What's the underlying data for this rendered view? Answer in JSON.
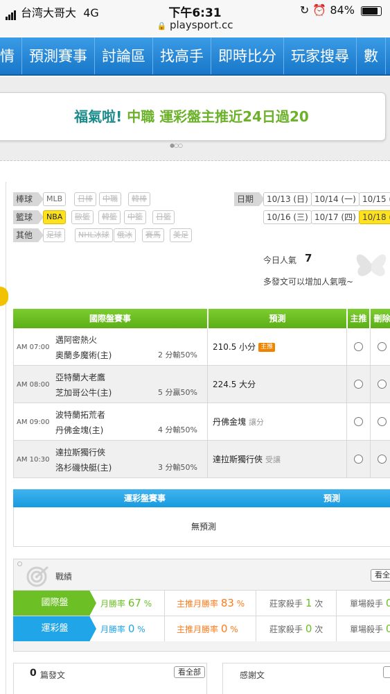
{
  "status_bar": {
    "carrier": "台湾大哥大",
    "network": "4G",
    "time": "下午6:31",
    "url": "playsport.cc",
    "battery": "84%",
    "battery_level": 0.84
  },
  "nav": {
    "items": [
      "情",
      "預測賽事",
      "討論區",
      "找高手",
      "即時比分",
      "玩家搜尋",
      "數"
    ]
  },
  "banner": {
    "prefix": "福氣啦!",
    "league": "中職",
    "text": "運彩盤主推近24日過20"
  },
  "filters": {
    "groups": [
      {
        "label": "棒球",
        "chips": [
          {
            "text": "MLB",
            "state": "normal"
          },
          {
            "text": "日棒",
            "state": "disabled"
          },
          {
            "text": "中職",
            "state": "disabled"
          },
          {
            "text": "韓棒",
            "state": "disabled"
          }
        ]
      },
      {
        "label": "籃球",
        "chips": [
          {
            "text": "NBA",
            "state": "active"
          },
          {
            "text": "歐籃",
            "state": "disabled"
          },
          {
            "text": "韓籃",
            "state": "disabled"
          },
          {
            "text": "中籃",
            "state": "disabled"
          },
          {
            "text": "日籃",
            "state": "disabled"
          }
        ]
      },
      {
        "label": "其他",
        "chips": [
          {
            "text": "足球",
            "state": "disabled"
          },
          {
            "text": "NHL冰球",
            "state": "disabled"
          },
          {
            "text": "俄冰",
            "state": "disabled"
          },
          {
            "text": "賽馬",
            "state": "disabled"
          },
          {
            "text": "美足",
            "state": "disabled"
          }
        ]
      }
    ],
    "date_label": "日期",
    "dates": [
      {
        "text": "10/13 (日)",
        "active": false
      },
      {
        "text": "10/14 (一)",
        "active": false
      },
      {
        "text": "10/15 (",
        "active": false
      },
      {
        "text": "10/16 (三)",
        "active": false
      },
      {
        "text": "10/17 (四)",
        "active": false
      },
      {
        "text": "10/18 (",
        "active": true
      }
    ]
  },
  "popularity": {
    "label": "今日人氣",
    "value": "7",
    "tip": "多發文可以增加人氣哦~"
  },
  "intl_table": {
    "headers": [
      "國際盤賽事",
      "預測",
      "主推",
      "刪除"
    ],
    "rows": [
      {
        "time": "AM 07:00",
        "away": "邁阿密熱火",
        "home": "奧蘭多魔術(主)",
        "line": "2 分輸50%",
        "prediction": "210.5 小分",
        "note": "",
        "badge": "主推"
      },
      {
        "time": "AM 08:00",
        "away": "亞特蘭大老鷹",
        "home": "芝加哥公牛(主)",
        "line": "5 分贏50%",
        "prediction": "224.5 大分",
        "note": "",
        "badge": ""
      },
      {
        "time": "AM 09:00",
        "away": "波特蘭拓荒者",
        "home": "丹佛金塊(主)",
        "line": "4 分輸50%",
        "prediction": "丹佛金塊",
        "note": "讓分",
        "badge": ""
      },
      {
        "time": "AM 10:30",
        "away": "達拉斯獨行俠",
        "home": "洛杉磯快艇(主)",
        "line": "3 分輸50%",
        "prediction": "達拉斯獨行俠",
        "note": "受讓",
        "badge": ""
      }
    ]
  },
  "lottery_table": {
    "headers": [
      "運彩盤賽事",
      "預測"
    ],
    "empty": "無預測"
  },
  "record": {
    "title": "戰績",
    "view_all": "看全",
    "rows": [
      {
        "tag": "國際盤",
        "rate_label": "月勝率",
        "rate": "67",
        "rate_unit": "%",
        "main_label": "主推月勝率",
        "main": "83",
        "main_unit": "%",
        "killer_label": "莊家殺手",
        "killer": "1",
        "killer_unit": "次",
        "single_label": "單場殺手",
        "single": "0"
      },
      {
        "tag": "運彩盤",
        "rate_label": "月勝率",
        "rate": "0",
        "rate_unit": "%",
        "main_label": "主推月勝率",
        "main": "0",
        "main_unit": "%",
        "killer_label": "莊家殺手",
        "killer": "0",
        "killer_unit": "次",
        "single_label": "單場殺手",
        "single": "0"
      }
    ]
  },
  "bottom": {
    "post_count": "0",
    "post_label": "篇發文",
    "view_all": "看全部",
    "thanks_label": "感謝文"
  },
  "colors": {
    "nav": "#1e86d6",
    "green": "#6cc025",
    "blue": "#1fa5e8",
    "yellow": "#ffe21f",
    "orange": "#ff7a1a",
    "teal": "#1a8a8a"
  }
}
